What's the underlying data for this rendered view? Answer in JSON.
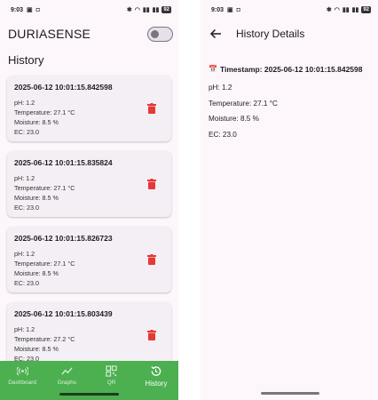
{
  "status_bar": {
    "left_phone_time": "9:03",
    "right_phone_time": "9:03",
    "battery": "92"
  },
  "app": {
    "title": "DURIASENSE",
    "dark_mode_toggle": "off"
  },
  "history": {
    "title": "History",
    "items": [
      {
        "timestamp": "2025-06-12 10:01:15.842598",
        "ph": "pH: 1.2",
        "temperature": "Temperature: 27.1 °C",
        "moisture": "Moisture: 8.5 %",
        "ec": "EC: 23.0"
      },
      {
        "timestamp": "2025-06-12 10:01:15.835824",
        "ph": "pH: 1.2",
        "temperature": "Temperature: 27.1 °C",
        "moisture": "Moisture: 8.5 %",
        "ec": "EC: 23.0"
      },
      {
        "timestamp": "2025-06-12 10:01:15.826723",
        "ph": "pH: 1.2",
        "temperature": "Temperature: 27.1 °C",
        "moisture": "Moisture: 8.5 %",
        "ec": "EC: 23.0"
      },
      {
        "timestamp": "2025-06-12 10:01:15.803439",
        "ph": "pH: 1.2",
        "temperature": "Temperature: 27.2 °C",
        "moisture": "Moisture: 8.5 %",
        "ec": "EC: 23.0"
      }
    ]
  },
  "bottom_nav": {
    "items": [
      {
        "label": "Dashboard",
        "icon": "sensor-icon"
      },
      {
        "label": "Graphs",
        "icon": "trend-chart-icon"
      },
      {
        "label": "QR",
        "icon": "qr-code-icon"
      },
      {
        "label": "History",
        "icon": "history-icon",
        "active": true
      }
    ]
  },
  "details": {
    "title": "History Details",
    "timestamp_label": "Timestamp: 2025-06-12 10:01:15.842598",
    "ph": "pH: 1.2",
    "temperature": "Temperature: 27.1 °C",
    "moisture": "Moisture: 8.5 %",
    "ec": "EC: 23.0"
  },
  "colors": {
    "nav_background": "#4caf50",
    "delete": "#e53935",
    "screen_background": "#fdf7fc",
    "card_background": "#f4eff5"
  }
}
